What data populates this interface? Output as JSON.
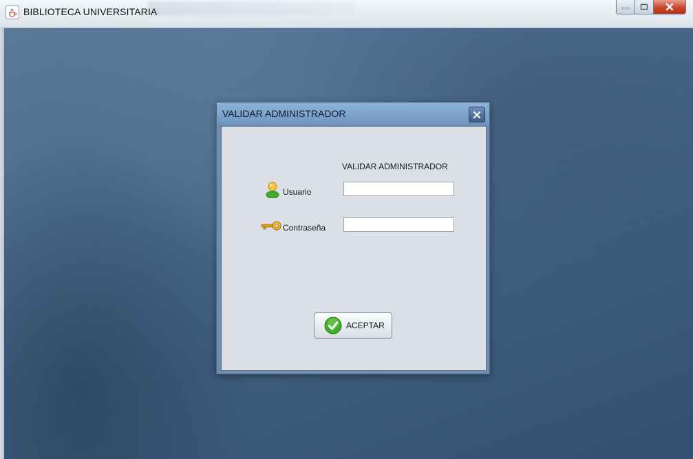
{
  "window": {
    "title": "BIBLIOTECA UNIVERSITARIA",
    "app_icon": "java-cup-icon",
    "buttons": [
      "minimize",
      "maximize",
      "close"
    ]
  },
  "dialog": {
    "title": "VALIDAR ADMINISTRADOR",
    "header": "VALIDAR ADMINISTRADOR",
    "fields": {
      "usuario": {
        "label": "Usuario",
        "value": "",
        "icon": "user-icon"
      },
      "contrasena": {
        "label": "Contraseña",
        "value": "",
        "icon": "key-icon"
      }
    },
    "accept_button": {
      "label": "ACEPTAR",
      "icon": "check-icon"
    }
  },
  "colors": {
    "desktop": "#4b6b8b",
    "dialog_frame": "#6f8db0",
    "dialog_body": "#dcdfe6",
    "close_red": "#c9452b",
    "check_green": "#3fae2a",
    "key_gold": "#e0a21a"
  }
}
